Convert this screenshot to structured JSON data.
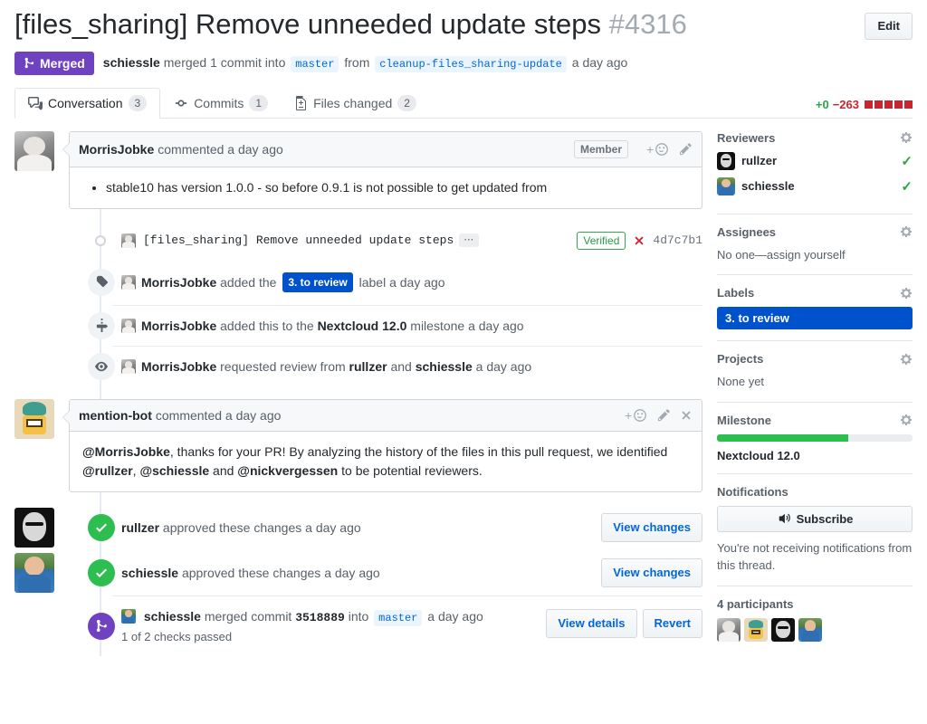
{
  "header": {
    "title": "[files_sharing] Remove unneeded update steps",
    "number": "#4316",
    "edit_label": "Edit",
    "state_badge": "Merged",
    "merged_by": "schiessle",
    "merged_text_1": "merged 1 commit into",
    "base_branch": "master",
    "from_word": "from",
    "head_branch": "cleanup-files_sharing-update",
    "merged_when": "a day ago"
  },
  "tabs": [
    {
      "label": "Conversation",
      "count": "3",
      "icon": "comment-discussion-icon",
      "selected": true
    },
    {
      "label": "Commits",
      "count": "1",
      "icon": "git-commit-icon",
      "selected": false
    },
    {
      "label": "Files changed",
      "count": "2",
      "icon": "diff-file-icon",
      "selected": false
    }
  ],
  "diffstat": {
    "additions": "+0",
    "deletions": "−263",
    "blocks": 5,
    "added_color": "#28a745",
    "deleted_color": "#cb2431"
  },
  "comments": [
    {
      "author": "MorrisJobke",
      "action": "commented",
      "when": "a day ago",
      "role": "Member",
      "body_items": [
        "stable10 has version 1.0.0 - so before 0.9.1 is not possible to get updated from"
      ],
      "avatar": "av-morris"
    }
  ],
  "commit_row": {
    "message": "[files_sharing] Remove unneeded update steps",
    "ellipsis": "⋯",
    "verified": "Verified",
    "status_icon": "x-failed-icon",
    "sha": "4d7c7b1"
  },
  "timeline": [
    {
      "icon": "tag-icon",
      "actor": "MorrisJobke",
      "text_before": "added the",
      "label": "3. to review",
      "text_after": "label",
      "when": "a day ago"
    },
    {
      "icon": "milestone-icon",
      "actor": "MorrisJobke",
      "text_before": "added this to the",
      "strong": "Nextcloud 12.0",
      "text_after": "milestone",
      "when": "a day ago"
    },
    {
      "icon": "eye-icon",
      "actor": "MorrisJobke",
      "text_before": "requested review from",
      "strong": "rullzer",
      "mid": "and",
      "strong2": "schiessle",
      "when": "a day ago"
    }
  ],
  "bot_comment": {
    "author": "mention-bot",
    "action": "commented",
    "when": "a day ago",
    "avatar": "av-bot",
    "line1_mention": "@MorrisJobke",
    "line1_rest": ", thanks for your PR! By analyzing the history of the files in this pull request, we identified",
    "line2_a": "@rullzer",
    "line2_sep1": ",",
    "line2_b": "@schiessle",
    "line2_sep2": "and",
    "line2_c": "@nickvergessen",
    "line2_rest": "to be potential reviewers."
  },
  "reviews": [
    {
      "actor": "rullzer",
      "text": "approved these changes",
      "when": "a day ago",
      "button": "View changes",
      "avatar": "av-rullzer"
    },
    {
      "actor": "schiessle",
      "text": "approved these changes",
      "when": "a day ago",
      "button": "View changes",
      "avatar": "av-schiessle"
    }
  ],
  "merge_event": {
    "actor": "schiessle",
    "text_before": "merged commit",
    "sha": "3518889",
    "text_mid": "into",
    "branch": "master",
    "when": "a day ago",
    "checks_note": "1 of 2 checks passed",
    "view_details": "View details",
    "revert": "Revert"
  },
  "sidebar": {
    "reviewers": {
      "title": "Reviewers",
      "people": [
        {
          "name": "rullzer",
          "approved": true,
          "avatar": "av-rullzer"
        },
        {
          "name": "schiessle",
          "approved": true,
          "avatar": "av-schiessle"
        }
      ]
    },
    "assignees": {
      "title": "Assignees",
      "empty": "No one—assign yourself"
    },
    "labels": {
      "title": "Labels",
      "items": [
        "3. to review"
      ],
      "color": "#0052cc"
    },
    "projects": {
      "title": "Projects",
      "empty": "None yet"
    },
    "milestone": {
      "title": "Milestone",
      "name": "Nextcloud 12.0",
      "progress_percent": 67,
      "bar_color": "#2cbe4e"
    },
    "notifications": {
      "title": "Notifications",
      "button": "Subscribe",
      "note": "You're not receiving notifications from this thread."
    },
    "participants": {
      "title": "4 participants",
      "avatars": [
        "av-morris",
        "av-bot",
        "av-rullzer",
        "av-schiessle"
      ]
    }
  }
}
